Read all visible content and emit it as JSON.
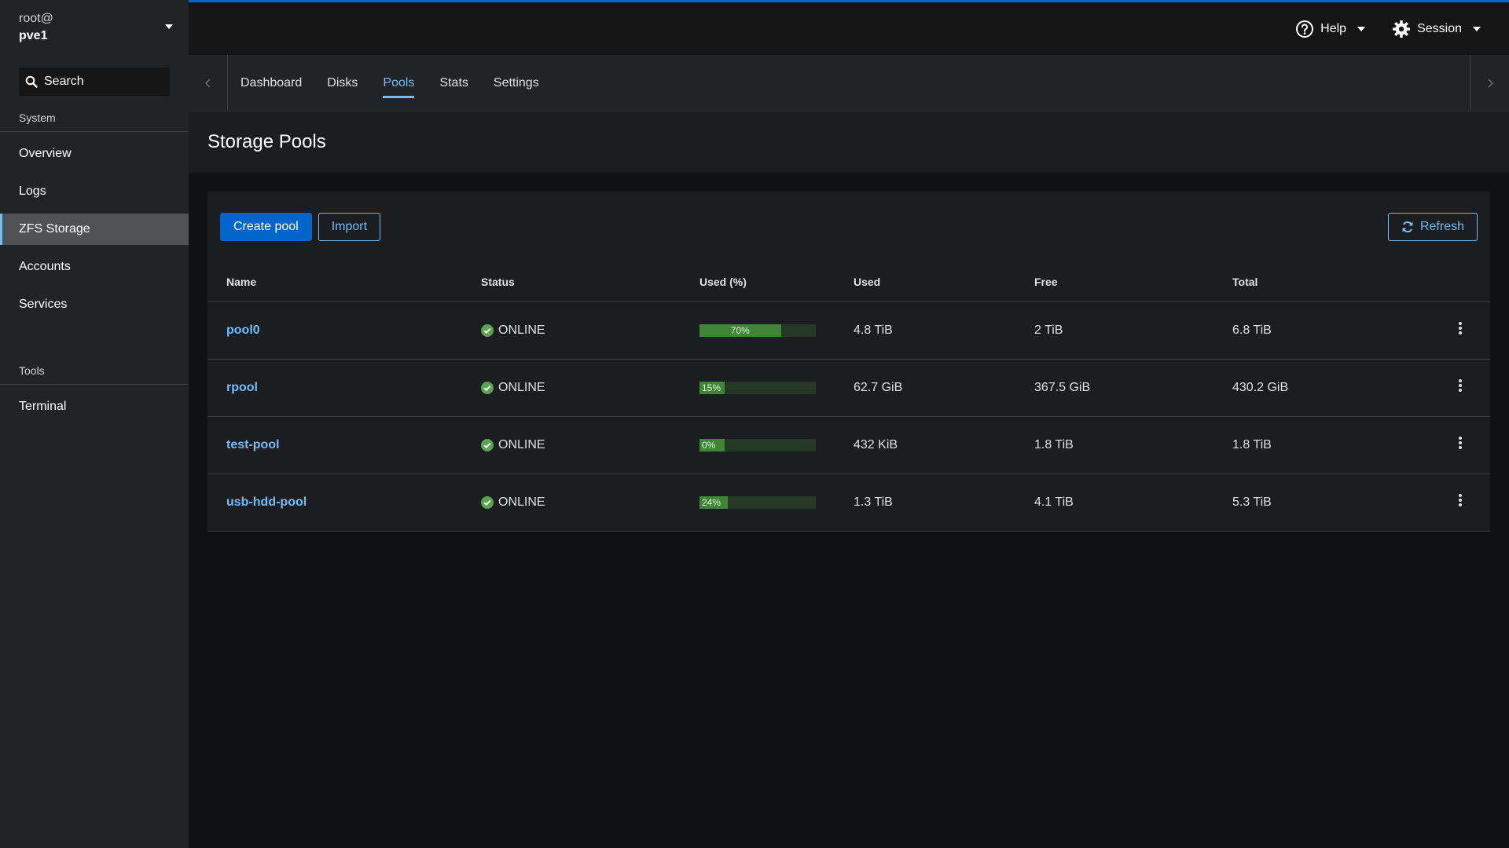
{
  "host": {
    "user": "root@",
    "name": "pve1"
  },
  "search": {
    "label": "Search"
  },
  "sidebar": {
    "sections": [
      {
        "title": "System",
        "items": [
          {
            "label": "Overview",
            "active": false
          },
          {
            "label": "Logs",
            "active": false
          },
          {
            "label": "ZFS Storage",
            "active": true
          },
          {
            "label": "Accounts",
            "active": false
          },
          {
            "label": "Services",
            "active": false
          }
        ]
      },
      {
        "title": "Tools",
        "items": [
          {
            "label": "Terminal",
            "active": false
          }
        ]
      }
    ]
  },
  "masthead": {
    "help": "Help",
    "session": "Session"
  },
  "tabs": [
    {
      "label": "Dashboard",
      "active": false
    },
    {
      "label": "Disks",
      "active": false
    },
    {
      "label": "Pools",
      "active": true
    },
    {
      "label": "Stats",
      "active": false
    },
    {
      "label": "Settings",
      "active": false
    }
  ],
  "page": {
    "title": "Storage Pools"
  },
  "toolbar": {
    "create": "Create pool",
    "import": "Import",
    "refresh": "Refresh"
  },
  "table": {
    "headers": [
      "Name",
      "Status",
      "Used (%)",
      "Used",
      "Free",
      "Total"
    ],
    "rows": [
      {
        "name": "pool0",
        "status": "ONLINE",
        "pct": 70,
        "pct_label": "70%",
        "used": "4.8 TiB",
        "free": "2 TiB",
        "total": "6.8 TiB"
      },
      {
        "name": "rpool",
        "status": "ONLINE",
        "pct": 15,
        "pct_label": "15%",
        "used": "62.7 GiB",
        "free": "367.5 GiB",
        "total": "430.2 GiB"
      },
      {
        "name": "test-pool",
        "status": "ONLINE",
        "pct": 0,
        "pct_label": "0%",
        "used": "432 KiB",
        "free": "1.8 TiB",
        "total": "1.8 TiB"
      },
      {
        "name": "usb-hdd-pool",
        "status": "ONLINE",
        "pct": 24,
        "pct_label": "24%",
        "used": "1.3 TiB",
        "free": "4.1 TiB",
        "total": "5.3 TiB"
      }
    ]
  },
  "colors": {
    "accent": "#0066cc",
    "link": "#73bcf7",
    "success": "#3e8635"
  }
}
